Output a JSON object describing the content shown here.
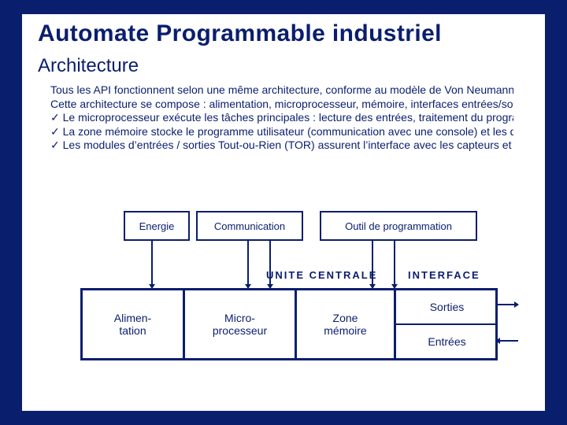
{
  "title": "Automate Programmable industriel",
  "subtitle": "Architecture",
  "paragraph": {
    "line1": "Tous les API fonctionnent selon une même architecture, conforme au modèle de Von Neumann / d’extension.",
    "line2": "Cette architecture se compose : alimentation, microprocesseur, mémoire, interfaces entrées/sorties et reste du système.",
    "line3": "✓ Le microprocesseur exécute les tâches principales : lecture des entrées, traitement du programme, mise à jour des sorties.",
    "line4": "✓ La zone mémoire stocke le programme utilisateur (communication avec une console) et les données d’exploitation.",
    "line5": "✓ Les modules d’entrées / sorties Tout-ou-Rien (TOR) assurent l’interface avec les capteurs et actionneurs."
  },
  "diagram": {
    "top": {
      "energie": "Energie",
      "comm": "Communication",
      "prog": "Outil de programmation"
    },
    "center": {
      "uc": "UNITE CENTRALE",
      "interface": "INTERFACE"
    },
    "block": {
      "alim": "Alimen-\ntation",
      "micro": "Micro-\nprocesseur",
      "mem": "Zone\nmémoire",
      "sorties": "Sorties",
      "entrees": "Entrées"
    }
  }
}
